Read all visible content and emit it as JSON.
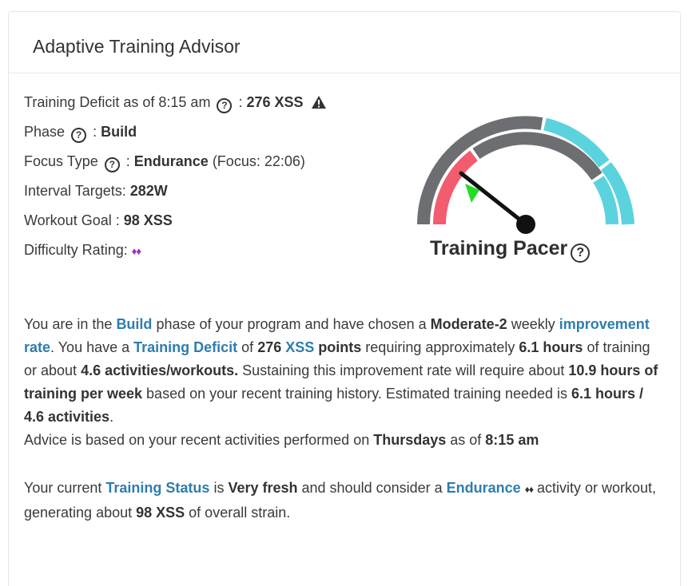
{
  "card": {
    "title": "Adaptive Training Advisor"
  },
  "stats": {
    "deficit_label": "Training Deficit as of 8:15 am",
    "deficit_value": "276 XSS",
    "phase_label": "Phase",
    "phase_value": "Build",
    "focus_label": "Focus Type",
    "focus_value": "Endurance",
    "focus_note": "(Focus: 22:06)",
    "interval_label": "Interval Targets:",
    "interval_value": "282W",
    "goal_label": "Workout Goal :",
    "goal_value": "98 XSS",
    "difficulty_label": "Difficulty Rating:",
    "difficulty_value": "♦♦"
  },
  "gauge": {
    "title": "Training Pacer",
    "colors": {
      "gray": "#6d6e71",
      "red": "#f25c6e",
      "cyan": "#5bd3df",
      "marker": "#22dd22",
      "needle": "#111111"
    }
  },
  "advice": {
    "p1": {
      "t1": "You are in the ",
      "build": "Build",
      "t2": " phase of your program and have chosen a ",
      "rate_name": "Moderate-2",
      "t3": " weekly ",
      "improvement_rate": "improvement rate",
      "t4": ". You have a ",
      "training_deficit": "Training Deficit",
      "t5": " of ",
      "deficit_num": "276",
      "t6": " ",
      "xss": "XSS",
      "t7": " ",
      "points": "points",
      "t8": " requiring approximately ",
      "hours": "6.1 hours",
      "t9": " of training or about ",
      "activities": "4.6 activities/workouts.",
      "t10": " Sustaining this improvement rate will require about ",
      "weekly_hours": "10.9 hours of training per week",
      "t11": " based on your recent training history. Estimated training needed is ",
      "estimate": "6.1 hours / 4.6 activities",
      "t12": ".",
      "t13": "Advice is based on your recent activities performed on ",
      "day": "Thursdays",
      "t14": " as of ",
      "time": "8:15 am"
    },
    "p2": {
      "t1": "Your current ",
      "training_status": "Training Status",
      "t2": " is ",
      "status_value": "Very fresh",
      "t3": " and should consider a ",
      "endurance": "Endurance",
      "t4": " ",
      "diamonds": "♦♦",
      "t5": " activity or workout, generating about ",
      "strain": "98 XSS",
      "t6": " of overall strain."
    }
  }
}
